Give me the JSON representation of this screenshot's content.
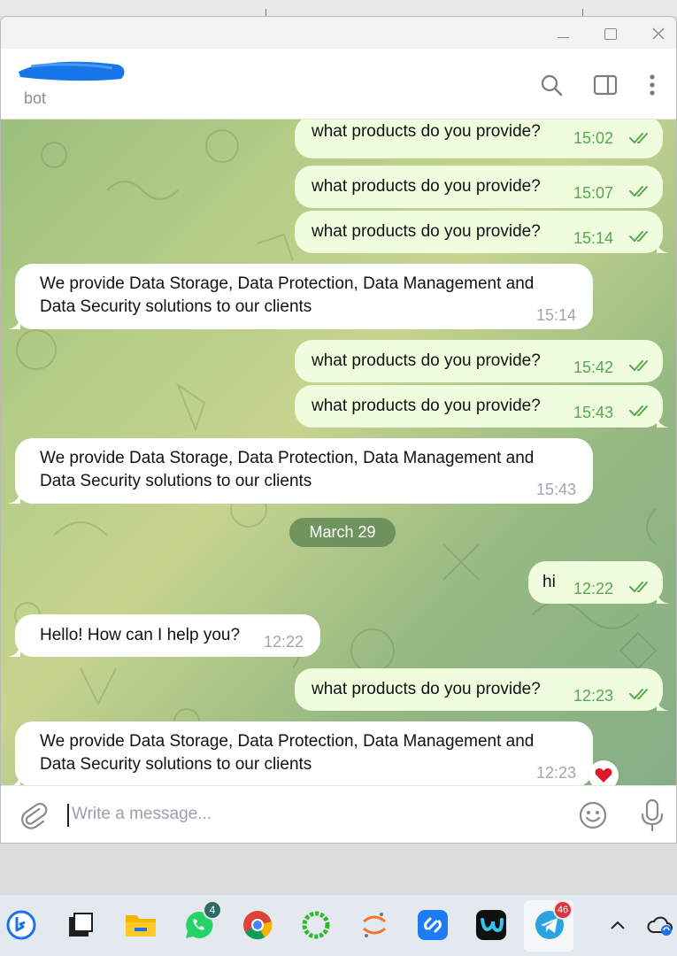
{
  "header": {
    "subtitle": "bot"
  },
  "messages": {
    "out1": {
      "text": "what products do you provide?",
      "time": "15:02"
    },
    "out2": {
      "text": "what products do you provide?",
      "time": "15:07"
    },
    "out3": {
      "text": "what products do you provide?",
      "time": "15:14"
    },
    "in1": {
      "line1": "We provide Data Storage, Data Protection, Data Management and",
      "line2": "Data Security solutions to our clients",
      "time": "15:14"
    },
    "out4": {
      "text": "what products do you provide?",
      "time": "15:42"
    },
    "out5": {
      "text": "what products do you provide?",
      "time": "15:43"
    },
    "in2": {
      "line1": "We provide Data Storage, Data Protection, Data Management and",
      "line2": "Data Security solutions to our clients",
      "time": "15:43"
    },
    "date_divider": "March 29",
    "out6": {
      "text": "hi",
      "time": "12:22"
    },
    "in3": {
      "text": "Hello! How can I help you?",
      "time": "12:22"
    },
    "out7": {
      "text": "what products do you provide?",
      "time": "12:23"
    },
    "in4": {
      "line1": "We provide Data Storage, Data Protection, Data Management and",
      "line2": "Data Security solutions to our clients",
      "time": "12:23",
      "reaction": "heart"
    }
  },
  "composer": {
    "placeholder": "Write a message..."
  },
  "taskbar": {
    "whatsapp_badge": "4",
    "telegram_badge": "46"
  },
  "colors": {
    "outgoing_bubble": "#effdde",
    "incoming_bubble": "#ffffff",
    "check_color": "#5aa653",
    "date_pill": "#5a8250"
  },
  "icons": [
    "minimize-icon",
    "maximize-icon",
    "close-icon",
    "search-icon",
    "side-panel-icon",
    "more-vertical-icon",
    "paperclip-icon",
    "emoji-icon",
    "microphone-icon",
    "double-check-icon",
    "heart-icon"
  ]
}
